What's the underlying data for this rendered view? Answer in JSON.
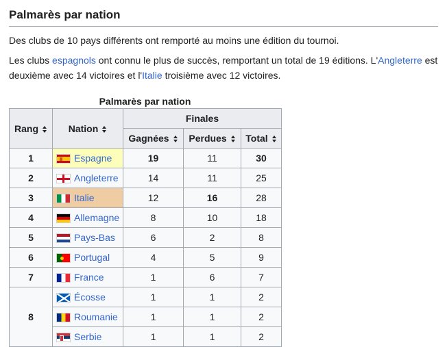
{
  "heading": "Palmarès par nation",
  "intro": {
    "p1": "Des clubs de 10 pays différents ont remporté au moins une édition du tournoi.",
    "p2_a": "Les clubs ",
    "p2_link1": "espagnols",
    "p2_b": " ont connu le plus de succès, remportant un total de 19 éditions. L'",
    "p2_link2": "Angleterre",
    "p2_c": " est deuxième avec 14 victoires et l'",
    "p2_link3": "Italie",
    "p2_d": " troisième avec 12 victoires."
  },
  "table": {
    "caption": "Palmarès par nation",
    "headers": {
      "rank": "Rang",
      "nation": "Nation",
      "finals": "Finales",
      "won": "Gagnées",
      "lost": "Perdues",
      "total": "Total"
    },
    "rows": [
      {
        "rank": "1",
        "nation": "Espagne",
        "flag": "spain-flag-icon",
        "won": "19",
        "lost": "11",
        "total": "30"
      },
      {
        "rank": "2",
        "nation": "Angleterre",
        "flag": "england-flag-icon",
        "won": "14",
        "lost": "11",
        "total": "25"
      },
      {
        "rank": "3",
        "nation": "Italie",
        "flag": "italy-flag-icon",
        "won": "12",
        "lost": "16",
        "total": "28"
      },
      {
        "rank": "4",
        "nation": "Allemagne",
        "flag": "germany-flag-icon",
        "won": "8",
        "lost": "10",
        "total": "18"
      },
      {
        "rank": "5",
        "nation": "Pays-Bas",
        "flag": "netherlands-flag-icon",
        "won": "6",
        "lost": "2",
        "total": "8"
      },
      {
        "rank": "6",
        "nation": "Portugal",
        "flag": "portugal-flag-icon",
        "won": "4",
        "lost": "5",
        "total": "9"
      },
      {
        "rank": "7",
        "nation": "France",
        "flag": "france-flag-icon",
        "won": "1",
        "lost": "6",
        "total": "7"
      },
      {
        "rank": "8",
        "nation": "Écosse",
        "flag": "scotland-flag-icon",
        "won": "1",
        "lost": "1",
        "total": "2"
      },
      {
        "nation": "Roumanie",
        "flag": "romania-flag-icon",
        "won": "1",
        "lost": "1",
        "total": "2"
      },
      {
        "nation": "Serbie",
        "flag": "serbia-flag-icon",
        "won": "1",
        "lost": "1",
        "total": "2"
      }
    ]
  },
  "colors": {
    "link": "#3366cc",
    "header_bg": "#eaecf0",
    "cell_bg": "#f8f9fa",
    "gold": "#fefebb",
    "bronze": "#f0cca2",
    "border": "#a2a9b1"
  }
}
